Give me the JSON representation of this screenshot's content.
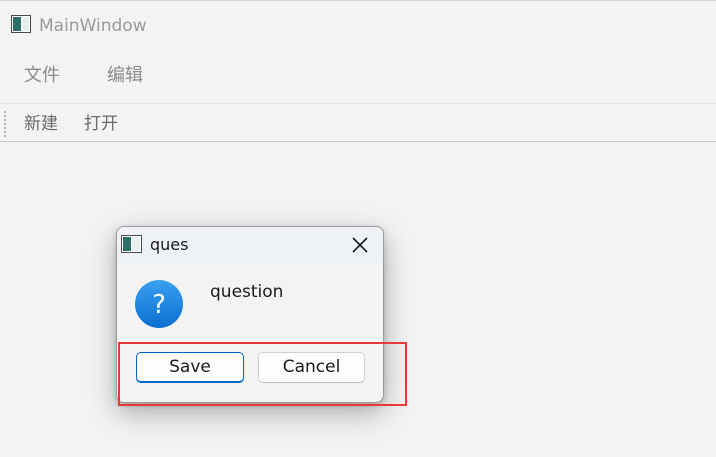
{
  "window": {
    "title": "MainWindow",
    "icon": "app-window-icon"
  },
  "menubar": {
    "items": [
      {
        "label": "文件"
      },
      {
        "label": "编辑"
      }
    ]
  },
  "toolbar": {
    "items": [
      {
        "label": "新建"
      },
      {
        "label": "打开"
      }
    ]
  },
  "dialog": {
    "title": "ques",
    "icon": "question-icon",
    "message": "question",
    "buttons": {
      "save_label": "Save",
      "cancel_label": "Cancel"
    },
    "default_button": "Save"
  },
  "annotation": {
    "highlight_color": "#e8393a",
    "highlight_target": "dialog-button-box"
  },
  "colors": {
    "accent": "#0067c0",
    "question_icon": "#1a7fdc",
    "window_background": "#f3f3f3"
  }
}
